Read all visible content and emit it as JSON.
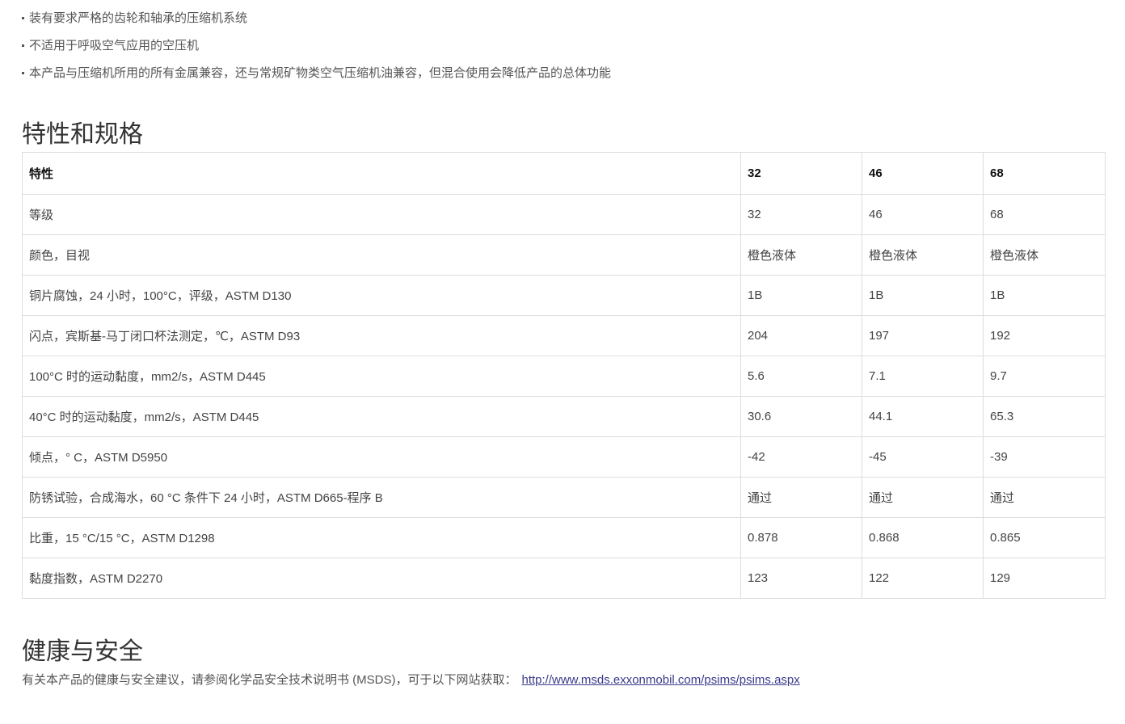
{
  "bullets": [
    "装有要求严格的齿轮和轴承的压缩机系统",
    "不适用于呼吸空气应用的空压机",
    "本产品与压缩机所用的所有金属兼容，还与常规矿物类空气压缩机油兼容，但混合使用会降低产品的总体功能"
  ],
  "specs": {
    "heading": "特性和规格",
    "header": [
      "特性",
      "32",
      "46",
      "68"
    ],
    "rows": [
      [
        "等级",
        "32",
        "46",
        "68"
      ],
      [
        "颜色，目视",
        "橙色液体",
        "橙色液体",
        "橙色液体"
      ],
      [
        "铜片腐蚀，24 小时，100°C，评级，ASTM D130",
        "1B",
        "1B",
        "1B"
      ],
      [
        "闪点，宾斯基-马丁闭口杯法测定，℃，ASTM D93",
        "204",
        "197",
        "192"
      ],
      [
        "100°C 时的运动黏度，mm2/s，ASTM D445",
        "5.6",
        "7.1",
        "9.7"
      ],
      [
        "40°C 时的运动黏度，mm2/s，ASTM D445",
        "30.6",
        "44.1",
        "65.3"
      ],
      [
        "倾点，° C，ASTM D5950",
        "-42",
        "-45",
        "-39"
      ],
      [
        "防锈试验，合成海水，60 °C 条件下 24 小时，ASTM D665-程序 B",
        "通过",
        "通过",
        "通过"
      ],
      [
        "比重，15 °C/15 °C，ASTM D1298",
        "0.878",
        "0.868",
        "0.865"
      ],
      [
        "黏度指数，ASTM D2270",
        "123",
        "122",
        "129"
      ]
    ]
  },
  "safety": {
    "heading": "健康与安全",
    "text": "有关本产品的健康与安全建议，请参阅化学品安全技术说明书 (MSDS)，可于以下网站获取：",
    "link": "http://www.msds.exxonmobil.com/psims/psims.aspx"
  }
}
